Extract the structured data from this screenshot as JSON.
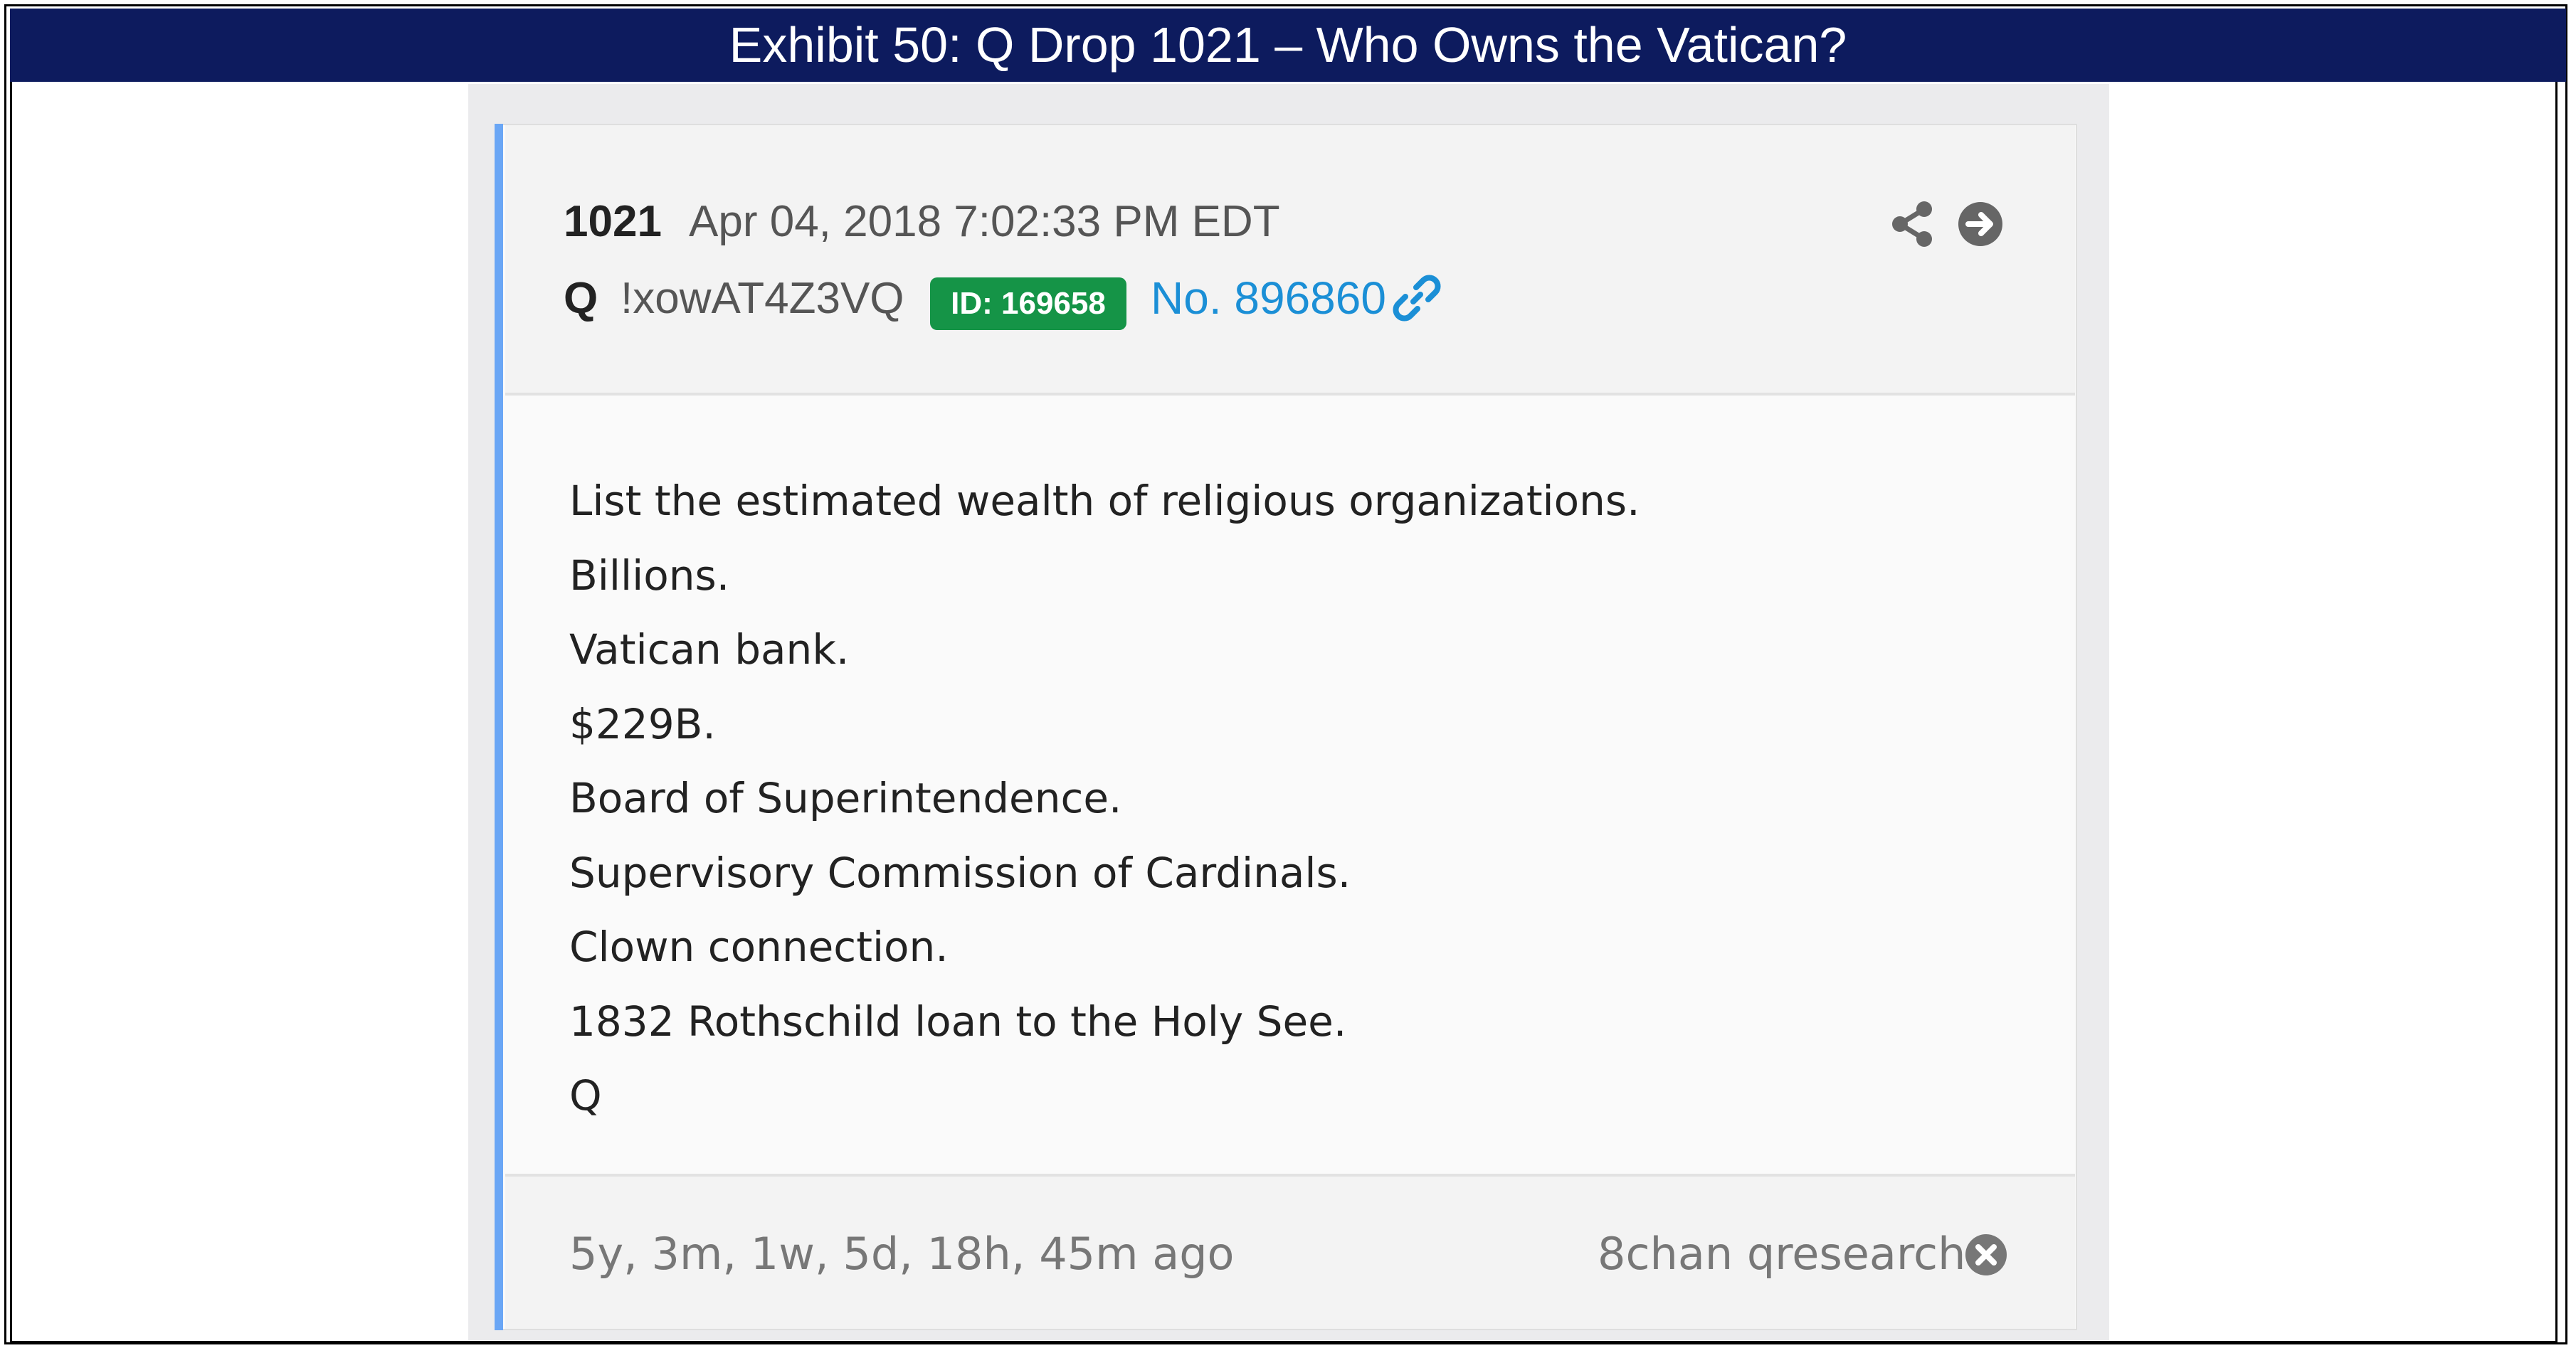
{
  "exhibit_title": "Exhibit 50: Q Drop 1021 – Who Owns the Vatican?",
  "post": {
    "drop_number": "1021",
    "date": "Apr 04, 2018 7:02:33 PM EDT",
    "author": "Q",
    "tripcode": "!xowAT4Z3VQ",
    "id_badge": "ID: 169658",
    "post_number": "No. 896860",
    "body": [
      "List the estimated wealth of religious organizations.",
      "Billions.",
      "Vatican bank.",
      "$229B.",
      "Board of Superintendence.",
      "Supervisory Commission of Cardinals.",
      "Clown connection.",
      "1832 Rothschild loan to the Holy See.",
      "Q"
    ],
    "time_ago": "5y, 3m, 1w, 5d, 18h, 45m ago",
    "source": "8chan qresearch"
  },
  "icons": {
    "share": "share-icon",
    "open": "arrow-circle-right-icon",
    "link": "link-icon",
    "close": "close-circle-icon"
  },
  "colors": {
    "title_bar": "#0d1b5e",
    "accent": "#6aa6f5",
    "id_badge": "#159447",
    "link": "#1b8fd6"
  }
}
